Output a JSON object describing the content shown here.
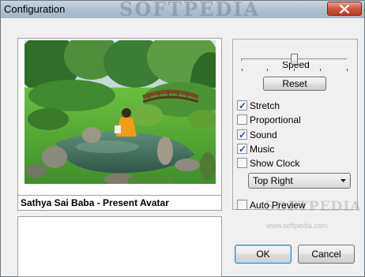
{
  "window": {
    "title": "Configuration",
    "watermark": "SOFTPEDIA"
  },
  "preview": {
    "caption": "Sathya Sai Baba - Present Avatar",
    "description": ""
  },
  "speed": {
    "label": "Speed",
    "level": 0.5
  },
  "buttons": {
    "reset": "Reset",
    "ok": "OK",
    "cancel": "Cancel"
  },
  "options": [
    {
      "label": "Stretch",
      "checked": true
    },
    {
      "label": "Proportional",
      "checked": false
    },
    {
      "label": "Sound",
      "checked": true
    },
    {
      "label": "Music",
      "checked": true
    },
    {
      "label": "Show Clock",
      "checked": false
    }
  ],
  "clock_position": {
    "selected": "Top Right"
  },
  "auto_preview": {
    "label": "Auto Preview",
    "checked": false
  },
  "watermark_small": "www.softpedia.com"
}
